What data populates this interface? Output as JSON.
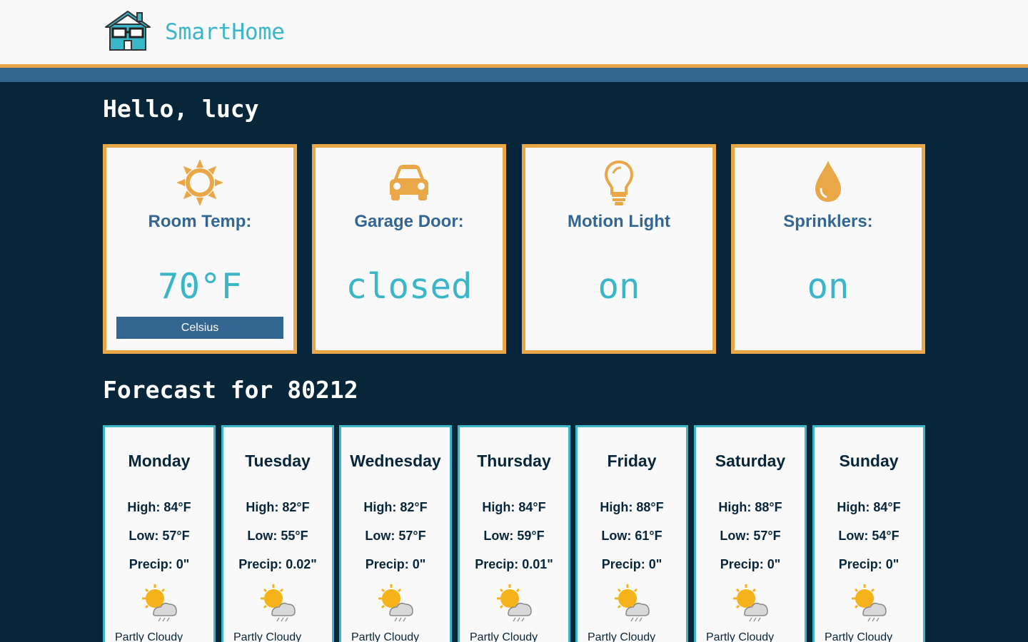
{
  "header": {
    "brand": "SmartHome",
    "logo_icon": "house-with-glasses-icon"
  },
  "greeting": "Hello, lucy",
  "devices": [
    {
      "label": "Room Temp:",
      "value": "70°F",
      "icon": "sun-icon",
      "button": "Celsius"
    },
    {
      "label": "Garage Door:",
      "value": "closed",
      "icon": "car-icon"
    },
    {
      "label": "Motion Light",
      "value": "on",
      "icon": "lightbulb-icon"
    },
    {
      "label": "Sprinklers:",
      "value": "on",
      "icon": "water-drop-icon"
    }
  ],
  "forecast": {
    "title": "Forecast for 80212",
    "days": [
      {
        "name": "Monday",
        "high": "High: 84°F",
        "low": "Low: 57°F",
        "precip": "Precip: 0\"",
        "condition": "Partly Cloudy"
      },
      {
        "name": "Tuesday",
        "high": "High: 82°F",
        "low": "Low: 55°F",
        "precip": "Precip: 0.02\"",
        "condition": "Partly Cloudy"
      },
      {
        "name": "Wednesday",
        "high": "High: 82°F",
        "low": "Low: 57°F",
        "precip": "Precip: 0\"",
        "condition": "Partly Cloudy"
      },
      {
        "name": "Thursday",
        "high": "High: 84°F",
        "low": "Low: 59°F",
        "precip": "Precip: 0.01\"",
        "condition": "Partly Cloudy"
      },
      {
        "name": "Friday",
        "high": "High: 88°F",
        "low": "Low: 61°F",
        "precip": "Precip: 0\"",
        "condition": "Partly Cloudy"
      },
      {
        "name": "Saturday",
        "high": "High: 88°F",
        "low": "Low: 57°F",
        "precip": "Precip: 0\"",
        "condition": "Partly Cloudy"
      },
      {
        "name": "Sunday",
        "high": "High: 84°F",
        "low": "Low: 54°F",
        "precip": "Precip: 0\"",
        "condition": "Partly Cloudy"
      }
    ]
  },
  "colors": {
    "accent_orange": "#eaa748",
    "brand_teal": "#3bb5c8",
    "navy_background": "#08263a",
    "steel_blue": "#336691"
  }
}
